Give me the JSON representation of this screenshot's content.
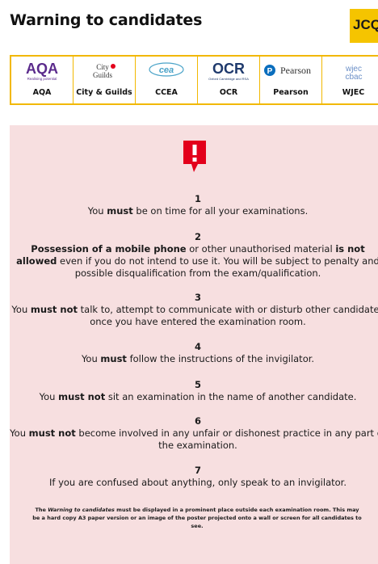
{
  "title": "Warning to candidates",
  "jcq_logo": {
    "text": "JCQ"
  },
  "boards": [
    {
      "name": "AQA",
      "logo_text": "AQA",
      "logo_sub": "Realising potential",
      "color": "#5b2b8c"
    },
    {
      "name": "City & Guilds",
      "logo_text": "City&Guilds",
      "color": "#333333"
    },
    {
      "name": "CCEA",
      "logo_text": "CCEA",
      "color": "#4aa3c8"
    },
    {
      "name": "OCR",
      "logo_text": "OCR",
      "logo_sub": "Oxford Cambridge and RSA",
      "color": "#1f3a6d"
    },
    {
      "name": "Pearson",
      "logo_text": "Pearson",
      "color": "#0a6ebd"
    },
    {
      "name": "WJEC",
      "logo_text": "wjec cbac",
      "color": "#6b8fc7"
    }
  ],
  "rules": [
    {
      "number": "1",
      "parts": [
        [
          "You ",
          false
        ],
        [
          "must",
          true
        ],
        [
          " be on time for all your examinations.",
          false
        ]
      ]
    },
    {
      "number": "2",
      "parts": [
        [
          "Possession of a mobile phone",
          true
        ],
        [
          " or other unauthorised material ",
          false
        ],
        [
          "is not allowed",
          true
        ],
        [
          " even if you do not intend to use it. You will be subject to penalty and possible disqualification from the exam/qualification.",
          false
        ]
      ]
    },
    {
      "number": "3",
      "parts": [
        [
          "You ",
          false
        ],
        [
          "must not",
          true
        ],
        [
          " talk to, attempt to communicate with or disturb other candidates once you have entered the examination room.",
          false
        ]
      ]
    },
    {
      "number": "4",
      "parts": [
        [
          "You ",
          false
        ],
        [
          "must",
          true
        ],
        [
          " follow the instructions of the invigilator.",
          false
        ]
      ]
    },
    {
      "number": "5",
      "parts": [
        [
          "You ",
          false
        ],
        [
          "must not",
          true
        ],
        [
          " sit an examination in the name of another candidate.",
          false
        ]
      ]
    },
    {
      "number": "6",
      "parts": [
        [
          "You ",
          false
        ],
        [
          "must not",
          true
        ],
        [
          " become involved in any unfair or dishonest practice in any part of the examination.",
          false
        ]
      ]
    },
    {
      "number": "7",
      "parts": [
        [
          "If you are confused about anything, only speak to an invigilator.",
          false
        ]
      ]
    }
  ],
  "footer": {
    "before": "The ",
    "italic": "Warning to candidates",
    "after": " must be displayed in a prominent place outside each examination room. This may be a hard copy A3 paper version or an image of the poster projected onto a wall or screen for all candidates to see."
  },
  "colors": {
    "panel": "#f7dfe0",
    "alert": "#e3001b",
    "accent": "#f5c400"
  }
}
